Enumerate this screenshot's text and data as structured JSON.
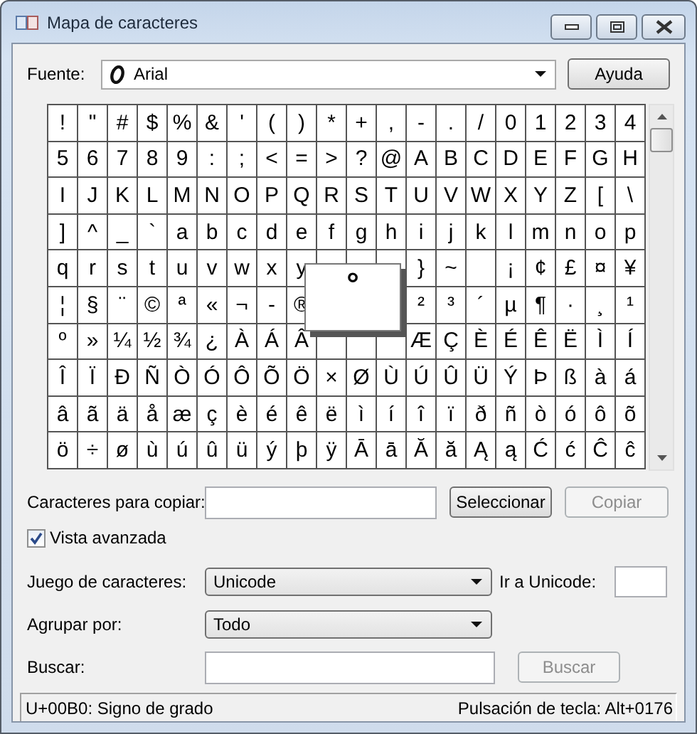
{
  "window": {
    "title": "Mapa de caracteres"
  },
  "font": {
    "label": "Fuente:",
    "value": "Arial"
  },
  "help_button": {
    "label": "Ayuda",
    "disabled": false
  },
  "grid": {
    "rows": [
      [
        "!",
        "\"",
        "#",
        "$",
        "%",
        "&",
        "'",
        "(",
        ")",
        "*",
        "+",
        ",",
        "-",
        ".",
        "/",
        "0",
        "1",
        "2",
        "3",
        "4"
      ],
      [
        "5",
        "6",
        "7",
        "8",
        "9",
        ":",
        ";",
        "<",
        "=",
        ">",
        "?",
        "@",
        "A",
        "B",
        "C",
        "D",
        "E",
        "F",
        "G",
        "H"
      ],
      [
        "I",
        "J",
        "K",
        "L",
        "M",
        "N",
        "O",
        "P",
        "Q",
        "R",
        "S",
        "T",
        "U",
        "V",
        "W",
        "X",
        "Y",
        "Z",
        "[",
        "\\"
      ],
      [
        "]",
        "^",
        "_",
        "`",
        "a",
        "b",
        "c",
        "d",
        "e",
        "f",
        "g",
        "h",
        "i",
        "j",
        "k",
        "l",
        "m",
        "n",
        "o",
        "p"
      ],
      [
        "q",
        "r",
        "s",
        "t",
        "u",
        "v",
        "w",
        "x",
        "y",
        null,
        null,
        null,
        "}",
        "~",
        null,
        "¡",
        "¢",
        "£",
        "¤",
        "¥"
      ],
      [
        "¦",
        "§",
        "¨",
        "©",
        "ª",
        "«",
        "¬",
        "-",
        "®",
        null,
        null,
        null,
        "²",
        "³",
        "´",
        "µ",
        "¶",
        "·",
        "¸",
        "¹"
      ],
      [
        "º",
        "»",
        "¼",
        "½",
        "¾",
        "¿",
        "À",
        "Á",
        "Â",
        null,
        null,
        null,
        "Æ",
        "Ç",
        "È",
        "É",
        "Ê",
        "Ë",
        "Ì",
        "Í"
      ],
      [
        "Î",
        "Ï",
        "Ð",
        "Ñ",
        "Ò",
        "Ó",
        "Ô",
        "Õ",
        "Ö",
        "×",
        "Ø",
        "Ù",
        "Ú",
        "Û",
        "Ü",
        "Ý",
        "Þ",
        "ß",
        "à",
        "á"
      ],
      [
        "â",
        "ã",
        "ä",
        "å",
        "æ",
        "ç",
        "è",
        "é",
        "ê",
        "ë",
        "ì",
        "í",
        "î",
        "ï",
        "ð",
        "ñ",
        "ò",
        "ó",
        "ô",
        "õ"
      ],
      [
        "ö",
        "÷",
        "ø",
        "ù",
        "ú",
        "û",
        "ü",
        "ý",
        "þ",
        "ÿ",
        "Ā",
        "ā",
        "Ă",
        "ă",
        "Ą",
        "ą",
        "Ć",
        "ć",
        "Ĉ",
        "ĉ"
      ]
    ],
    "magnified": "°"
  },
  "copy": {
    "label": "Caracteres para copiar:"
  },
  "select_button": {
    "label": "Seleccionar",
    "disabled": false
  },
  "copy_button": {
    "label": "Copiar",
    "disabled": true
  },
  "advanced_view": {
    "label": "Vista avanzada",
    "checked": true
  },
  "charset": {
    "label": "Juego de caracteres:",
    "value": "Unicode"
  },
  "goto_unicode": {
    "label": "Ir a Unicode:"
  },
  "group_by": {
    "label": "Agrupar por:",
    "value": "Todo"
  },
  "search": {
    "label": "Buscar:"
  },
  "search_button": {
    "label": "Buscar",
    "disabled": true
  },
  "status_bar": {
    "description": "U+00B0: Signo de grado",
    "keystroke": "Pulsación de tecla: Alt+0176"
  }
}
